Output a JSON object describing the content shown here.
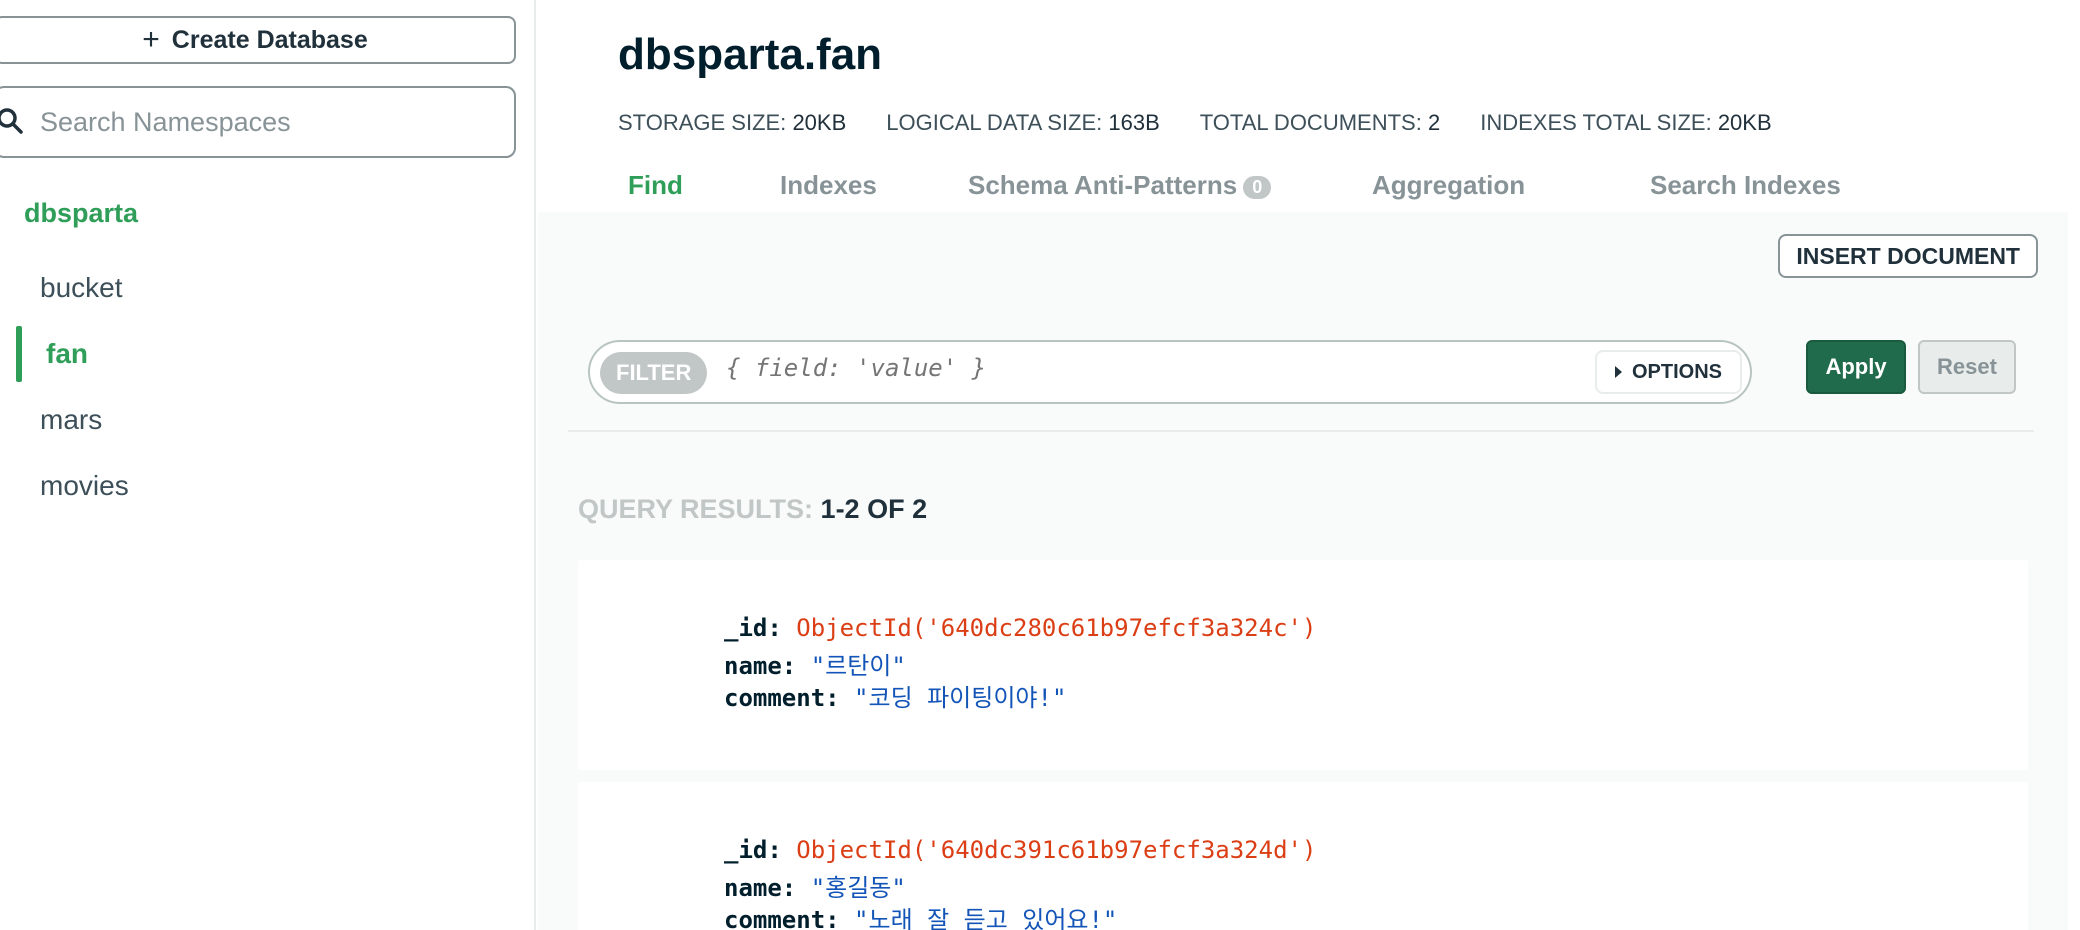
{
  "sidebar": {
    "create_database_label": "Create Database",
    "search_placeholder": "Search Namespaces",
    "database": "dbsparta",
    "collections": [
      {
        "label": "bucket",
        "active": false
      },
      {
        "label": "fan",
        "active": true
      },
      {
        "label": "mars",
        "active": false
      },
      {
        "label": "movies",
        "active": false
      }
    ]
  },
  "header": {
    "title": "dbsparta.fan",
    "stats": [
      {
        "label": "STORAGE SIZE:",
        "value": "20KB"
      },
      {
        "label": "LOGICAL DATA SIZE:",
        "value": "163B"
      },
      {
        "label": "TOTAL DOCUMENTS:",
        "value": "2"
      },
      {
        "label": "INDEXES TOTAL SIZE:",
        "value": "20KB"
      }
    ]
  },
  "tabs": [
    {
      "label": "Find",
      "active": true
    },
    {
      "label": "Indexes",
      "active": false
    },
    {
      "label": "Schema Anti-Patterns",
      "badge": "0",
      "active": false
    },
    {
      "label": "Aggregation",
      "active": false
    },
    {
      "label": "Search Indexes",
      "active": false
    }
  ],
  "toolbar": {
    "insert_label": "INSERT DOCUMENT",
    "filter_label": "FILTER",
    "filter_placeholder": "{ field: 'value' }",
    "options_label": "OPTIONS",
    "apply_label": "Apply",
    "reset_label": "Reset"
  },
  "results": {
    "label": "QUERY RESULTS:",
    "range": "1-2 OF 2"
  },
  "documents": [
    {
      "id_key": "_id:",
      "id_value": "ObjectId('640dc280c61b97efcf3a324c')",
      "name_key": "name:",
      "name_value": "\"르탄이\"",
      "comment_key": "comment:",
      "comment_value": "\"코딩 파이팅이야!\""
    },
    {
      "id_key": "_id:",
      "id_value": "ObjectId('640dc391c61b97efcf3a324d')",
      "name_key": "name:",
      "name_value": "\"홍길동\"",
      "comment_key": "comment:",
      "comment_value": "\"노래 잘 듣고 있어요!\""
    }
  ],
  "colors": {
    "accent_green": "#2f9e58",
    "apply_green": "#1f6b4b",
    "objectid_red": "#db3e15",
    "string_blue": "#1254b7"
  }
}
